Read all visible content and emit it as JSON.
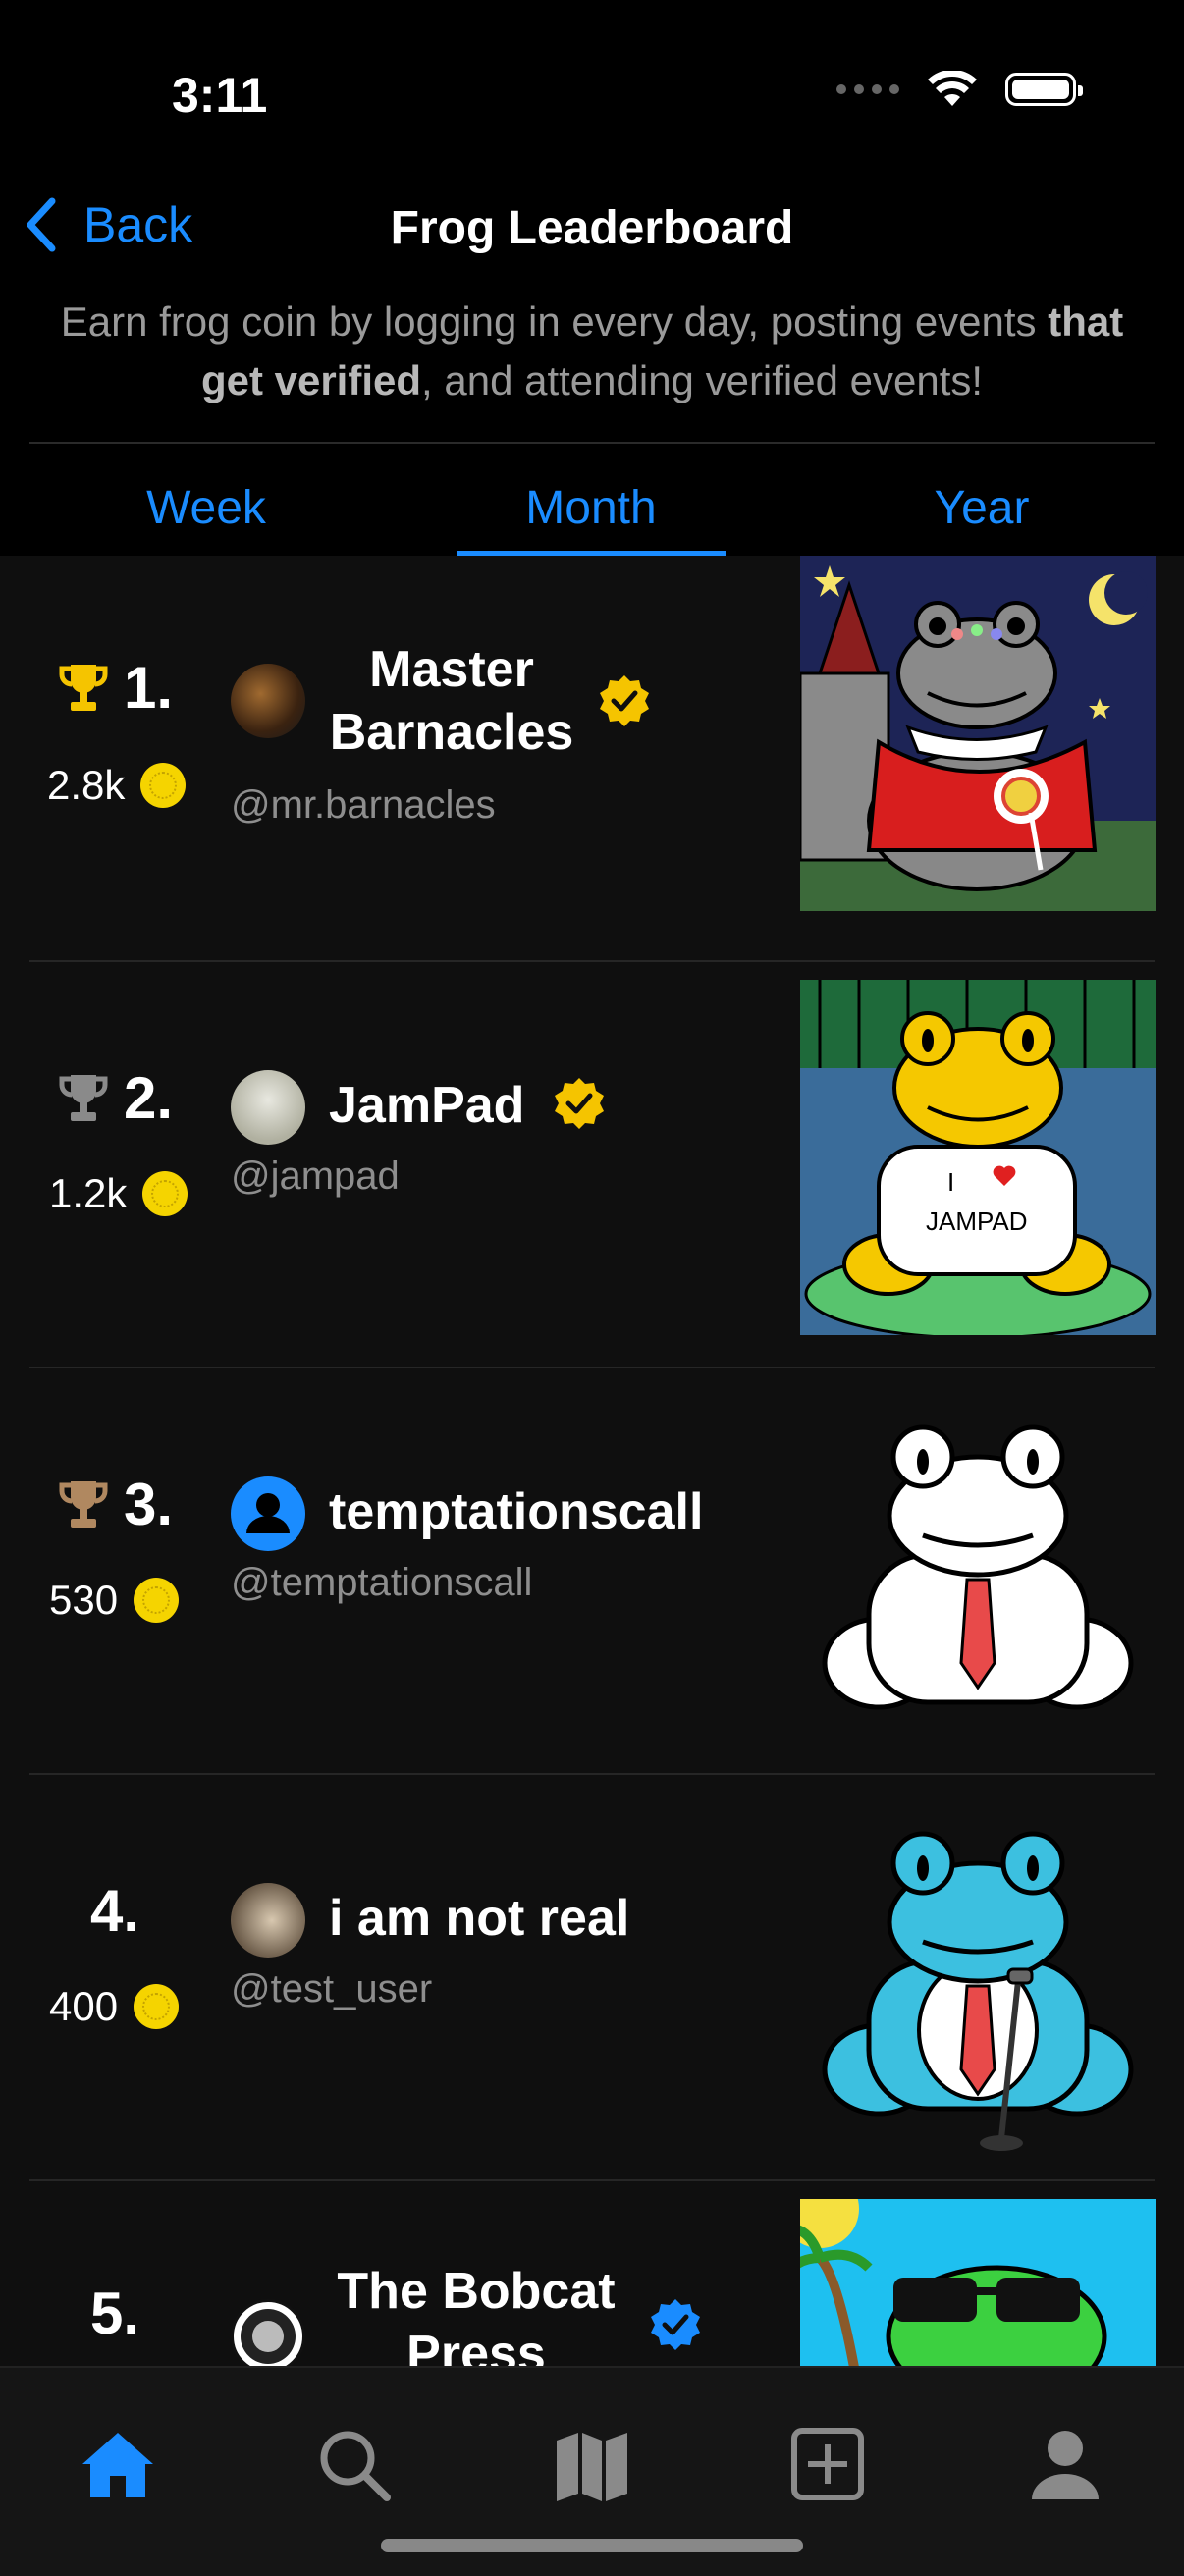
{
  "status_bar": {
    "time": "3:11"
  },
  "nav": {
    "back_label": "Back",
    "title": "Frog Leaderboard"
  },
  "subtitle": {
    "part1": "Earn frog coin by logging in every day, posting events ",
    "bold": "that get verified",
    "part2": ", and attending verified events!"
  },
  "tabs": {
    "week": "Week",
    "month": "Month",
    "year": "Year",
    "selected": "Month"
  },
  "colors": {
    "accent": "#1a8cff",
    "gold": "#f5c400",
    "silver": "#8a8a8a",
    "bronze": "#b08860",
    "coin": "#f5d400"
  },
  "leaderboard": [
    {
      "rank": "1.",
      "trophy": "gold-trophy-icon",
      "coins": "2.8k",
      "name_line1": "Master",
      "name_line2": "Barnacles",
      "handle": "@mr.barnacles",
      "badge": "gold-verified-icon"
    },
    {
      "rank": "2.",
      "trophy": "silver-trophy-icon",
      "coins": "1.2k",
      "name": "JamPad",
      "handle": "@jampad",
      "badge": "gold-verified-icon",
      "shirt_text_1": "I",
      "shirt_text_2": "JAMPAD"
    },
    {
      "rank": "3.",
      "trophy": "bronze-trophy-icon",
      "coins": "530",
      "name": "temptationscall",
      "handle": "@temptationscall"
    },
    {
      "rank": "4.",
      "coins": "400",
      "name": "i am not real",
      "handle": "@test_user"
    },
    {
      "rank": "5.",
      "name_line1": "The Bobcat",
      "name_line2": "Press",
      "badge": "blue-verified-icon"
    }
  ],
  "tabbar": [
    "home-icon",
    "search-icon",
    "map-icon",
    "add-icon",
    "profile-icon"
  ],
  "tabbar_selected": "home-icon"
}
